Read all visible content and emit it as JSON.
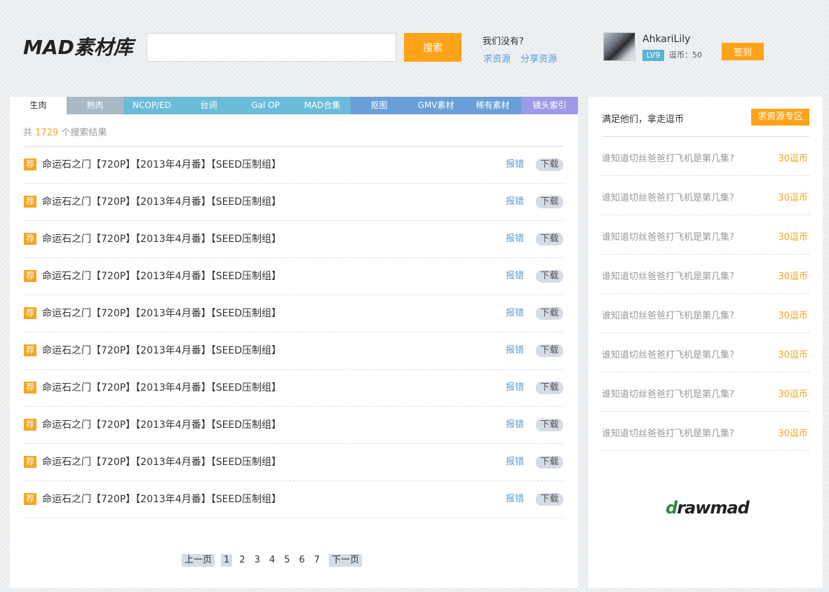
{
  "header": {
    "logo": "MAD素材库",
    "search": {
      "value": "",
      "placeholder": ""
    },
    "search_button": "搜索",
    "missing_title": "我们没有?",
    "request_link": "求资源",
    "share_link": "分享资源"
  },
  "user": {
    "name": "AhkariLily",
    "level": "LV9",
    "coins": "逗币：50",
    "signin": "签到"
  },
  "tabs": [
    {
      "label": "生肉",
      "color": "#ffffff"
    },
    {
      "label": "熟肉",
      "color": "#a9b9c6"
    },
    {
      "label": "NCOP/ED",
      "color": "#6bbcd9"
    },
    {
      "label": "台词",
      "color": "#6bbcd9"
    },
    {
      "label": "Gal OP",
      "color": "#6bbcd9"
    },
    {
      "label": "MAD合集",
      "color": "#6bbcd9"
    },
    {
      "label": "抠图",
      "color": "#6a9fd9"
    },
    {
      "label": "GMV素材",
      "color": "#6a9fd9"
    },
    {
      "label": "稀有素材",
      "color": "#6a9fd9"
    },
    {
      "label": "镜头索引",
      "color": "#9b9be8"
    }
  ],
  "results": {
    "prefix": "共",
    "count": "1729",
    "suffix": "个搜索结果"
  },
  "list": {
    "badge": "荐",
    "report": "报错",
    "download": "下载",
    "items": [
      "命运石之门【720P】【2013年4月番】【SEED压制组】",
      "命运石之门【720P】【2013年4月番】【SEED压制组】",
      "命运石之门【720P】【2013年4月番】【SEED压制组】",
      "命运石之门【720P】【2013年4月番】【SEED压制组】",
      "命运石之门【720P】【2013年4月番】【SEED压制组】",
      "命运石之门【720P】【2013年4月番】【SEED压制组】",
      "命运石之门【720P】【2013年4月番】【SEED压制组】",
      "命运石之门【720P】【2013年4月番】【SEED压制组】",
      "命运石之门【720P】【2013年4月番】【SEED压制组】",
      "命运石之门【720P】【2013年4月番】【SEED压制组】"
    ]
  },
  "pagination": {
    "prev": "上一页",
    "next": "下一页",
    "pages": [
      "1",
      "2",
      "3",
      "4",
      "5",
      "6",
      "7"
    ],
    "current": "1"
  },
  "sidebar": {
    "title": "满足他们，拿走逗币",
    "zone_button": "求资源专区",
    "items": [
      {
        "question": "谁知道切丝爸爸打飞机是第几集?",
        "reward": "30逗币"
      },
      {
        "question": "谁知道切丝爸爸打飞机是第几集?",
        "reward": "30逗币"
      },
      {
        "question": "谁知道切丝爸爸打飞机是第几集?",
        "reward": "30逗币"
      },
      {
        "question": "谁知道切丝爸爸打飞机是第几集?",
        "reward": "30逗币"
      },
      {
        "question": "谁知道切丝爸爸打飞机是第几集?",
        "reward": "30逗币"
      },
      {
        "question": "谁知道切丝爸爸打飞机是第几集?",
        "reward": "30逗币"
      },
      {
        "question": "谁知道切丝爸爸打飞机是第几集?",
        "reward": "30逗币"
      },
      {
        "question": "谁知道切丝爸爸打飞机是第几集?",
        "reward": "30逗币"
      }
    ],
    "brand_first": "d",
    "brand_rest": "rawmad"
  },
  "colors": {
    "accent": "#ffa31a",
    "link": "#5b9bd5",
    "badge": "#f5a623"
  }
}
